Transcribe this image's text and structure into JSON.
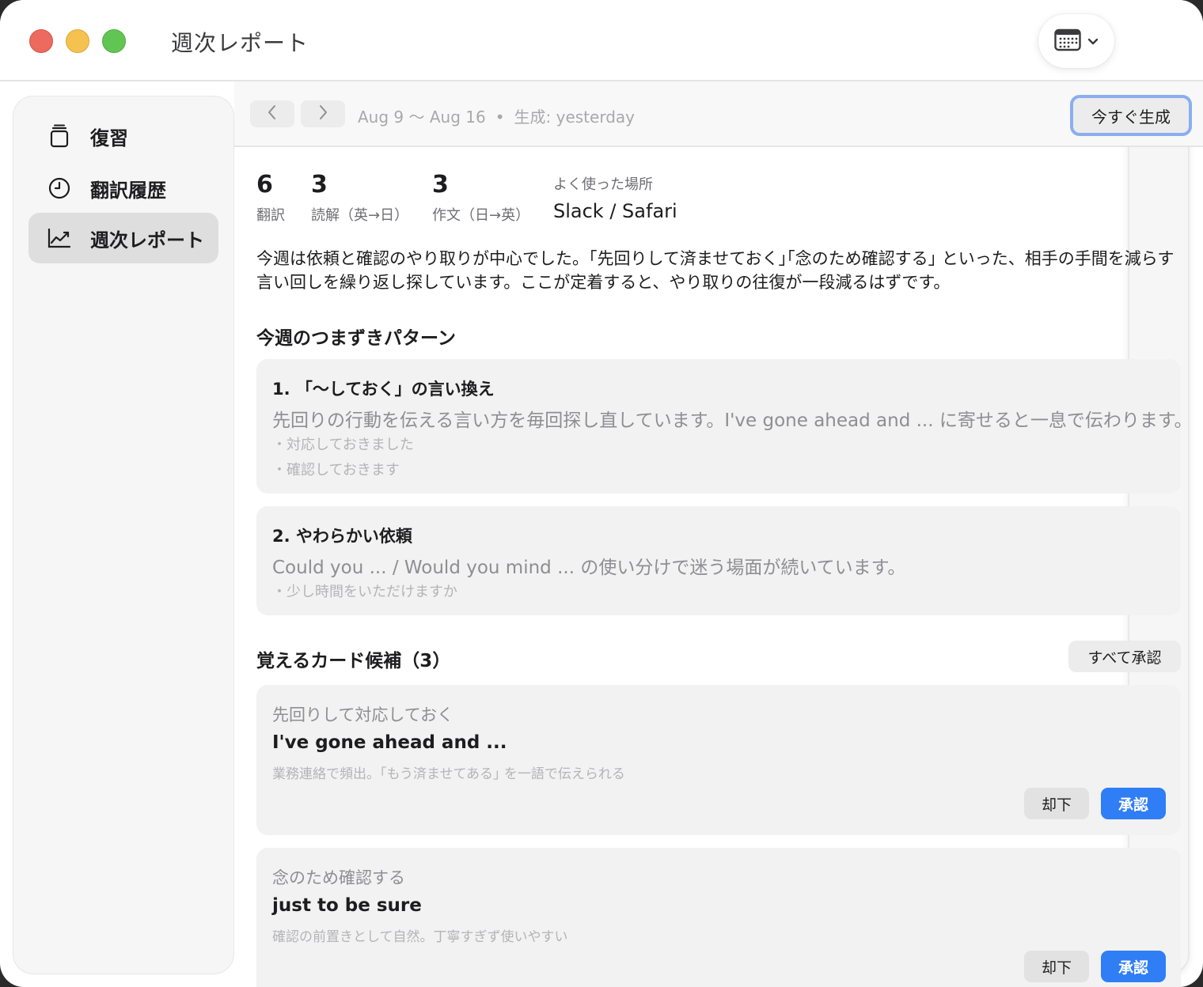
{
  "window": {
    "title": "週次レポート"
  },
  "sidebar": {
    "items": [
      {
        "label": "復習",
        "icon": "review-icon",
        "active": false
      },
      {
        "label": "翻訳履歴",
        "icon": "clock-icon",
        "active": false
      },
      {
        "label": "週次レポート",
        "icon": "chart-icon",
        "active": true
      }
    ]
  },
  "toolbar": {
    "range": "Aug 9 〜 Aug 16",
    "separator": "•",
    "generated": "生成: yesterday",
    "generate_label": "今すぐ生成"
  },
  "stats": {
    "translations": {
      "value": "6",
      "label": "翻訳"
    },
    "reading": {
      "value": "3",
      "label": "読解（英→日）"
    },
    "writing": {
      "value": "3",
      "label": "作文（日→英）"
    },
    "place": {
      "label": "よく使った場所",
      "value": "Slack / Safari"
    }
  },
  "summary": "今週は依頼と確認のやり取りが中心でした。｢先回りして済ませておく｣｢念のため確認する｣ といった、相手の手間を減らす言い回しを繰り返し探しています。ここが定着すると、やり取りの往復が一段減るはずです。",
  "patterns": {
    "title": "今週のつまずきパターン",
    "items": [
      {
        "title": "1. 「〜しておく」の言い換え",
        "desc": "先回りの行動を伝える言い方を毎回探し直しています。I've gone ahead and ... に寄せると一息で伝わります。",
        "examples": [
          "・対応しておきました",
          "・確認しておきます"
        ]
      },
      {
        "title": "2. やわらかい依頼",
        "desc": "Could you ... / Would you mind ... の使い分けで迷う場面が続いています。",
        "examples": [
          "・少し時間をいただけますか"
        ]
      }
    ]
  },
  "cards": {
    "title": "覚えるカード候補（3）",
    "accept_all": "すべて承認",
    "reject_label": "却下",
    "approve_label": "承認",
    "items": [
      {
        "ja": "先回りして対応しておく",
        "en": "I've gone ahead and ...",
        "note": "業務連絡で頻出。｢もう済ませてある｣ を一語で伝えられる"
      },
      {
        "ja": "念のため確認する",
        "en": "just to be sure",
        "note": "確認の前置きとして自然。丁寧すぎず使いやすい"
      }
    ]
  },
  "colors": {
    "accent": "#2f7ef5",
    "focus_ring": "#8aaeef"
  }
}
